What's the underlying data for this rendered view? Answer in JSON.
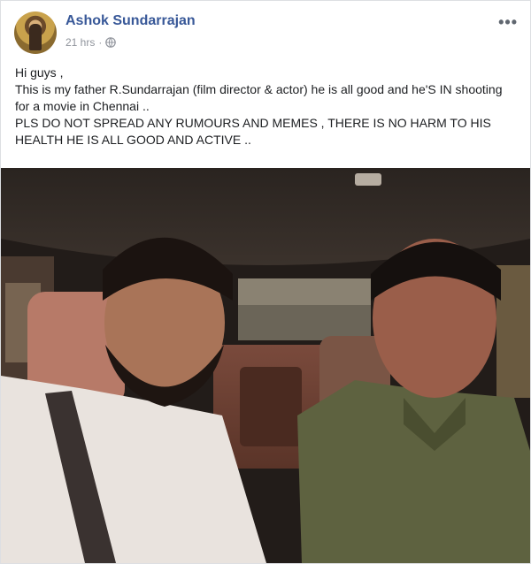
{
  "post": {
    "author": "Ashok Sundarrajan",
    "time": "21 hrs",
    "separator": "·",
    "privacy_icon": "globe-icon",
    "more_icon": "ellipsis-icon",
    "text_lines": [
      "Hi guys ,",
      "This is my father R.Sundarrajan (film director & actor) he is all good and he'S IN shooting for a movie in Chennai ..",
      "PLS DO NOT SPREAD ANY RUMOURS AND MEMES , THERE IS NO HARM TO HIS HEALTH HE IS ALL GOOD AND ACTIVE .."
    ]
  },
  "colors": {
    "author_link": "#385898",
    "meta_gray": "#90949c"
  }
}
